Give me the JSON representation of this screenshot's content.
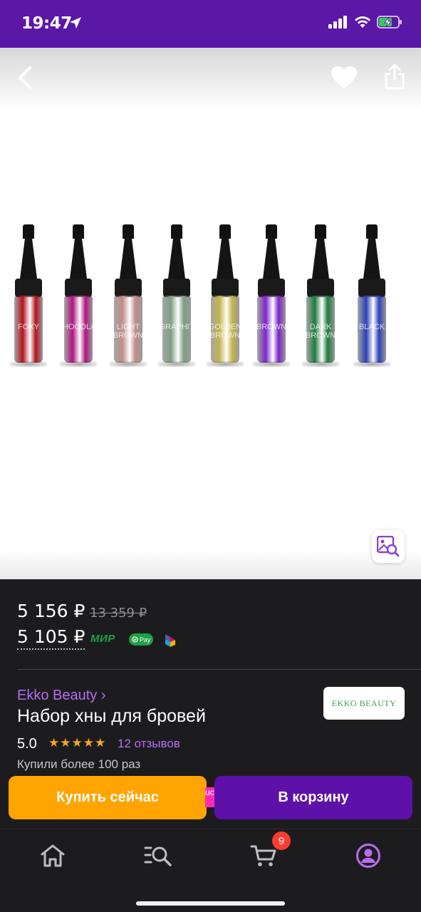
{
  "status": {
    "time": "19:47"
  },
  "nav": {
    "back_icon": "chevron-left-icon",
    "favorite_icon": "heart-icon",
    "share_icon": "share-icon",
    "image_search_icon": "image-search-icon"
  },
  "product_image": {
    "bottles": [
      {
        "label": "FOXY",
        "color": "#b3131d"
      },
      {
        "label": "CHOCOLAT",
        "color": "#b0147f"
      },
      {
        "label": "LIGHT BROWN",
        "color": "#c08d86"
      },
      {
        "label": "GRAPHIT",
        "color": "#7e9e84"
      },
      {
        "label": "GOLDEN BROWN",
        "color": "#c2b54a"
      },
      {
        "label": "BROWN",
        "color": "#7b23c9"
      },
      {
        "label": "DARK BROWN",
        "color": "#1e7a3e"
      },
      {
        "label": "BLACK",
        "color": "#2a3fb8"
      }
    ]
  },
  "price": {
    "current": "5 156 ₽",
    "old": "13 359 ₽",
    "card_price": "5 105 ₽",
    "mir_label": "МИР",
    "spay_label": "Pay"
  },
  "product": {
    "brand": "Ekko Beauty ›",
    "title": "Набор хны для бровей",
    "brand_logo_text": "EKKO BEAUTY",
    "rating": "5.0",
    "stars": "★★★★★",
    "reviews": "12 отзывов",
    "bought": "Купили более 100 раз"
  },
  "actions": {
    "buy_now": "Купить сейчас",
    "promo_fragment": "uc",
    "to_cart": "В корзину"
  },
  "tabbar": {
    "cart_badge": "9"
  },
  "colors": {
    "accent_purple": "#5b17a6",
    "buy_orange": "#ffa400",
    "link_purple": "#b86cf0",
    "star_orange": "#f5a623"
  }
}
